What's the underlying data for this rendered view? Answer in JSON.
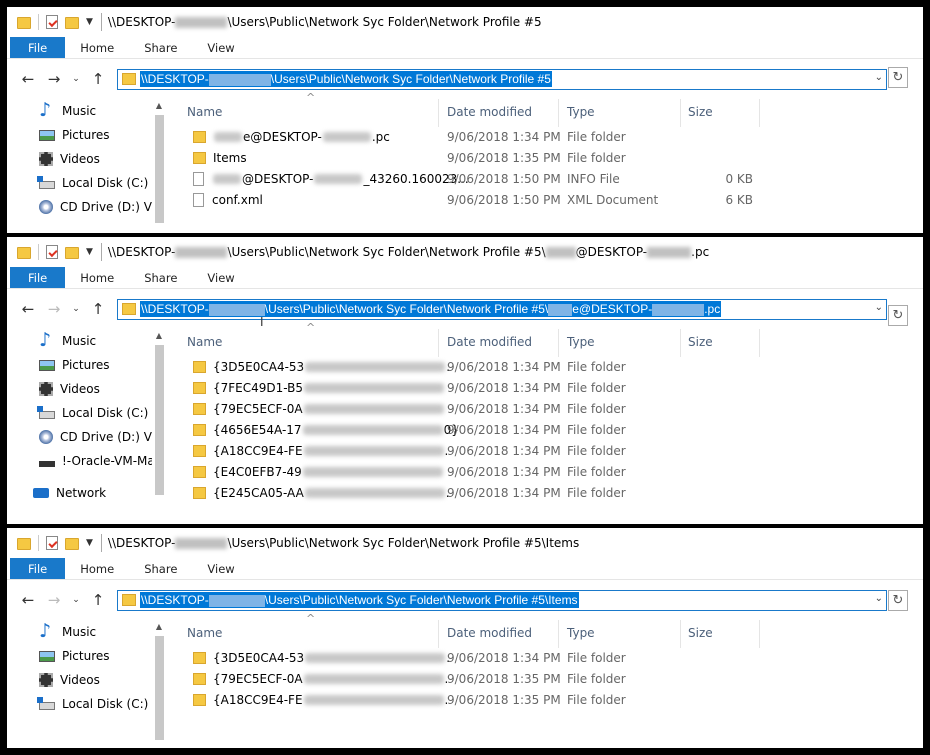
{
  "ribbon": {
    "file": "File",
    "home": "Home",
    "share": "Share",
    "view": "View"
  },
  "columns": {
    "name": "Name",
    "date": "Date modified",
    "type": "Type",
    "size": "Size"
  },
  "pane1": {
    "title_prefix": "\\\\DESKTOP-",
    "title_suffix": "\\Users\\Public\\Network Syc Folder\\Network Profile #5",
    "addr_prefix": "\\\\DESKTOP-",
    "addr_suffix": "\\Users\\Public\\Network Syc Folder\\Network Profile #5",
    "sidebar": [
      "Music",
      "Pictures",
      "Videos",
      "Local Disk (C:)",
      "CD Drive (D:) Vir"
    ],
    "rows": [
      {
        "pre": "",
        "mid": "e@DESKTOP-",
        "post": ".pc",
        "date": "9/06/2018 1:34 PM",
        "type": "File folder",
        "size": ""
      },
      {
        "pre": "",
        "mid": "Items",
        "post": "",
        "date": "9/06/2018 1:35 PM",
        "type": "File folder",
        "size": ""
      },
      {
        "pre": "",
        "mid": "@DESKTOP-",
        "post": "_43260.160023...",
        "date": "9/06/2018 1:50 PM",
        "type": "INFO File",
        "size": "0 KB"
      },
      {
        "pre": "",
        "mid": "conf.xml",
        "post": "",
        "date": "9/06/2018 1:50 PM",
        "type": "XML Document",
        "size": "6 KB"
      }
    ]
  },
  "pane2": {
    "title_prefix": "\\\\DESKTOP-",
    "title_mid": "\\Users\\Public\\Network Syc Folder\\Network Profile #5\\",
    "title_mid2": "@DESKTOP-",
    "title_suffix": ".pc",
    "addr_prefix": "\\\\DESKTOP-",
    "addr_mid": "\\Users\\Public\\Network Syc Folder\\Network Profile #5\\",
    "addr_mid2": "e@DESKTOP-",
    "addr_suffix": ".pc",
    "sidebar": [
      "Music",
      "Pictures",
      "Videos",
      "Local Disk (C:)",
      "CD Drive (D:) Vir",
      "!-Oracle-VM-Ma",
      "Network"
    ],
    "rows": [
      {
        "name": "{3D5E0CA4-53",
        "tail": ".",
        "date": "9/06/2018 1:34 PM",
        "type": "File folder"
      },
      {
        "name": "{7FEC49D1-B5",
        "tail": "",
        "date": "9/06/2018 1:34 PM",
        "type": "File folder"
      },
      {
        "name": "{79EC5ECF-0A",
        "tail": "",
        "date": "9/06/2018 1:34 PM",
        "type": "File folder"
      },
      {
        "name": "{4656E54A-17",
        "tail": "0}",
        "date": "9/06/2018 1:34 PM",
        "type": "File folder"
      },
      {
        "name": "{A18CC9E4-FE",
        "tail": ".",
        "date": "9/06/2018 1:34 PM",
        "type": "File folder"
      },
      {
        "name": "{E4C0EFB7-49",
        "tail": "",
        "date": "9/06/2018 1:34 PM",
        "type": "File folder"
      },
      {
        "name": "{E245CA05-AA",
        "tail": ".",
        "date": "9/06/2018 1:34 PM",
        "type": "File folder"
      }
    ]
  },
  "pane3": {
    "title_prefix": "\\\\DESKTOP-",
    "title_suffix": "\\Users\\Public\\Network Syc Folder\\Network Profile #5\\Items",
    "addr_prefix": "\\\\DESKTOP-",
    "addr_suffix": "\\Users\\Public\\Network Syc Folder\\Network Profile #5\\Items",
    "sidebar": [
      "Music",
      "Pictures",
      "Videos",
      "Local Disk (C:)"
    ],
    "rows": [
      {
        "name": "{3D5E0CA4-53",
        "tail": ".",
        "date": "9/06/2018 1:34 PM",
        "type": "File folder"
      },
      {
        "name": "{79EC5ECF-0A",
        "tail": ".",
        "date": "9/06/2018 1:35 PM",
        "type": "File folder"
      },
      {
        "name": "{A18CC9E4-FE",
        "tail": ".",
        "date": "9/06/2018 1:35 PM",
        "type": "File folder"
      }
    ]
  }
}
